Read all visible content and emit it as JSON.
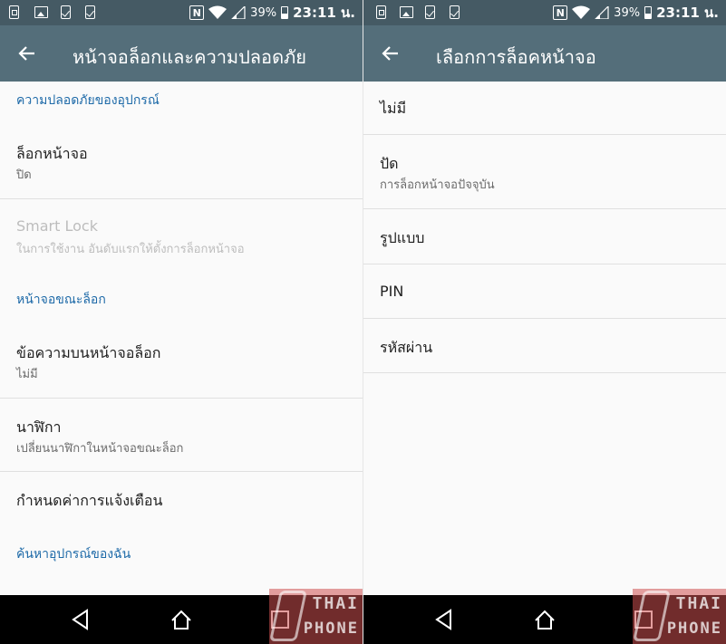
{
  "status_bar": {
    "notification_icons": [
      "sim-card-icon",
      "image-icon",
      "clipboard-check-icon",
      "clipboard-check-icon"
    ],
    "nfc_label": "N",
    "battery_percent": "39%",
    "time": "23:11 น."
  },
  "left": {
    "title": "หน้าจอล็อกและความปลอดภัย",
    "sections": {
      "device_security": "ความปลอดภัยของอุปกรณ์",
      "lock_screen": "หน้าจอขณะล็อก",
      "find_device": "ค้นหาอุปกรณ์ของฉัน"
    },
    "items": {
      "screen_lock": {
        "title": "ล็อกหน้าจอ",
        "summary": "ปิด"
      },
      "smart_lock": {
        "title": "Smart Lock",
        "summary": "ในการใช้งาน อันดับแรกให้ตั้งการล็อกหน้าจอ"
      },
      "lock_message": {
        "title": "ข้อความบนหน้าจอล็อก",
        "summary": "ไม่มี"
      },
      "clock": {
        "title": "นาฬิกา",
        "summary": "เปลี่ยนนาฬิกาในหน้าจอขณะล็อก"
      },
      "notifications": {
        "title": "กำหนดค่าการแจ้งเตือน"
      }
    }
  },
  "right": {
    "title": "เลือกการล็อคหน้าจอ",
    "options": [
      {
        "title": "ไม่มี",
        "summary": ""
      },
      {
        "title": "ปัด",
        "summary": "การล็อกหน้าจอปัจจุบัน"
      },
      {
        "title": "รูปแบบ",
        "summary": ""
      },
      {
        "title": "PIN",
        "summary": ""
      },
      {
        "title": "รหัสผ่าน",
        "summary": ""
      }
    ]
  },
  "navigation": {
    "buttons": [
      "back-icon",
      "home-icon",
      "recents-icon"
    ]
  },
  "watermark": {
    "line1": "THAI",
    "line2": "PHONE"
  },
  "colors": {
    "status_bar": "#455a64",
    "toolbar": "#546e7a",
    "section_header": "#1e6aa8",
    "background": "#fafafa"
  }
}
